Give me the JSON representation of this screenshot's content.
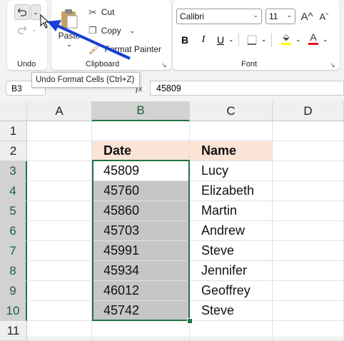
{
  "ribbon": {
    "undo_group_label": "Undo",
    "clipboard_group_label": "Clipboard",
    "font_group_label": "Font",
    "paste_label": "Paste",
    "cut_label": "Cut",
    "copy_label": "Copy",
    "format_painter_label": "Format Painter",
    "font_name": "Calibri",
    "font_size": "11",
    "increase_font_label": "A^",
    "decrease_font_label": "Aˇ",
    "bold_label": "B",
    "italic_label": "I",
    "underline_label": "U",
    "font_color_label": "A",
    "font_color": "#e81123",
    "fill_color": "#ffff00"
  },
  "tooltip": {
    "text": "Undo Format Cells (Ctrl+Z)"
  },
  "formula_bar": {
    "name_box": "B3",
    "value": "45809",
    "fx_label": "fx"
  },
  "columns": [
    "A",
    "B",
    "C",
    "D"
  ],
  "rows": [
    "1",
    "2",
    "3",
    "4",
    "5",
    "6",
    "7",
    "8",
    "9",
    "10",
    "11"
  ],
  "table": {
    "headers": {
      "date": "Date",
      "name": "Name"
    },
    "rows": [
      {
        "date": "45809",
        "name": "Lucy"
      },
      {
        "date": "45760",
        "name": "Elizabeth"
      },
      {
        "date": "45860",
        "name": "Martin"
      },
      {
        "date": "45703",
        "name": "Andrew"
      },
      {
        "date": "45991",
        "name": "Steve"
      },
      {
        "date": "45934",
        "name": "Jennifer"
      },
      {
        "date": "46012",
        "name": "Geoffrey"
      },
      {
        "date": "45742",
        "name": "Steve"
      }
    ]
  },
  "colors": {
    "accent": "#217346",
    "header_fill": "#fbe4d5",
    "arrow": "#1a3fd6"
  }
}
